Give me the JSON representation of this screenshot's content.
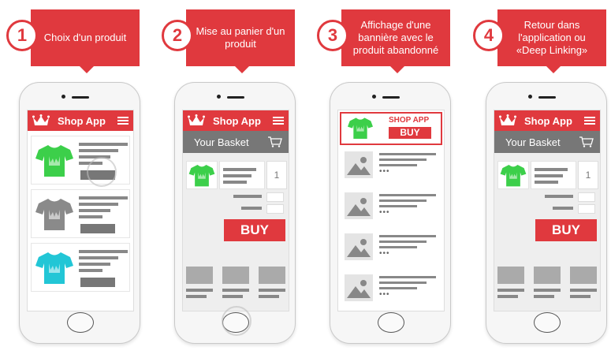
{
  "colors": {
    "accent": "#e0393e",
    "dark": "#777777"
  },
  "steps": [
    {
      "number": "1",
      "text": "Choix d'un produit"
    },
    {
      "number": "2",
      "text": "Mise au panier d'un produit"
    },
    {
      "number": "3",
      "text": "Affichage d'une bannière avec le produit abandonné"
    },
    {
      "number": "4",
      "text": "Retour dans l'application ou «Deep Linking»"
    }
  ],
  "app": {
    "title": "Shop App",
    "basket": "Your Basket",
    "quantity": "1",
    "buy": "BUY",
    "banner_title": "SHOP APP",
    "banner_buy": "BUY",
    "icons": [
      "crown-icon",
      "hamburger-menu-icon",
      "shopping-cart-icon",
      "image-placeholder-icon",
      "t-shirt-icon"
    ],
    "product_colors": [
      "#3ccf4a",
      "#8a8a8a",
      "#22c6d6"
    ]
  }
}
